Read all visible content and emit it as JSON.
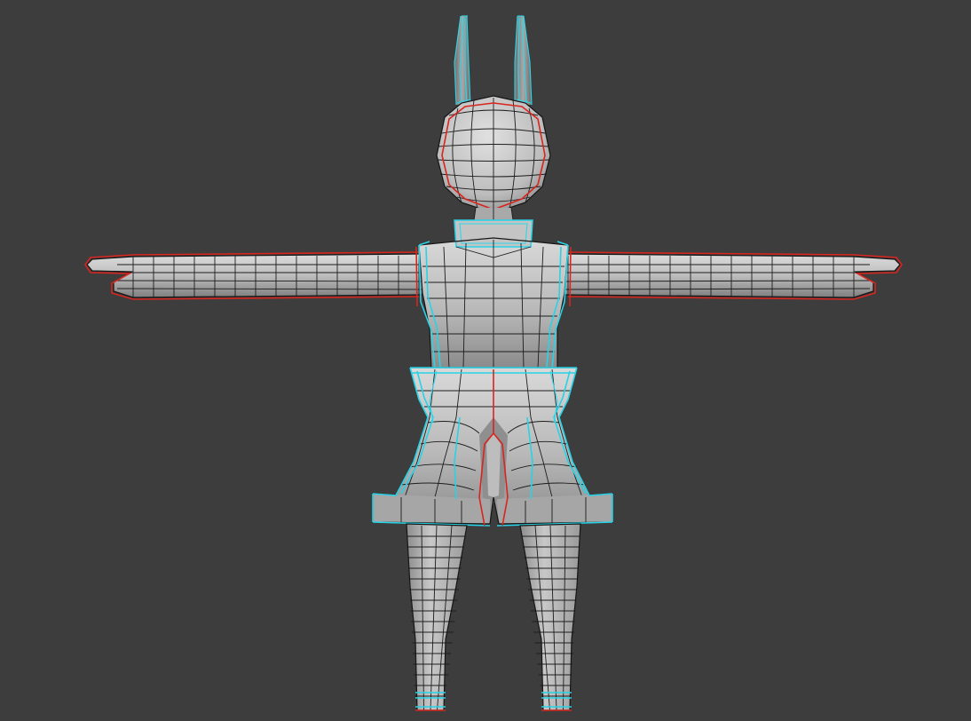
{
  "viewport": {
    "background": "#3d3d3d",
    "mode": "edit-mode-uv-seams",
    "object": "low-poly-character-t-pose"
  },
  "colors": {
    "mesh_light": "#d2d2d2",
    "mesh_dark": "#7c7c7c",
    "wireframe": "#1d1d1d",
    "seam": "#d7261f",
    "selected_edges": "#27d3e6"
  }
}
